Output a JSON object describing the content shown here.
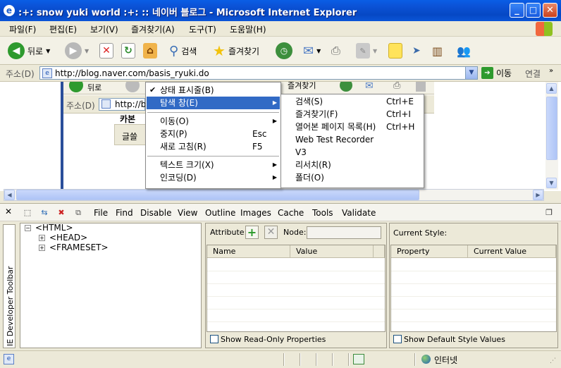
{
  "window": {
    "title": ":+: snow yuki world :+: :: 네이버 블로그 - Microsoft Internet Explorer",
    "minimize": "_",
    "maximize": "□",
    "close": "✕"
  },
  "menubar": [
    "파일(F)",
    "편집(E)",
    "보기(V)",
    "즐겨찾기(A)",
    "도구(T)",
    "도움말(H)"
  ],
  "toolbar": {
    "back": "뒤로",
    "search": "검색",
    "favorites": "즐겨찾기"
  },
  "address": {
    "label": "주소(D)",
    "url": "http://blog.naver.com/basis_ryuki.do",
    "go": "이동",
    "links": "연결"
  },
  "page_behind": {
    "back": "뒤로",
    "favorites": "즐겨찾기",
    "address_label": "주소(D)",
    "url": "http://b",
    "tab1": "카본",
    "tab2": "글쓸"
  },
  "context_menu": {
    "items": [
      {
        "label": "상태 표시줄(B)",
        "checked": "✔",
        "shortcut": "",
        "submenu": false
      },
      {
        "label": "탐색 창(E)",
        "checked": "",
        "shortcut": "",
        "submenu": true,
        "selected": true
      },
      {
        "label": "이동(O)",
        "checked": "",
        "shortcut": "",
        "submenu": true
      },
      {
        "label": "중지(P)",
        "checked": "",
        "shortcut": "Esc",
        "submenu": false
      },
      {
        "label": "새로 고침(R)",
        "checked": "",
        "shortcut": "F5",
        "submenu": false
      },
      {
        "label": "텍스트 크기(X)",
        "checked": "",
        "shortcut": "",
        "submenu": true
      },
      {
        "label": "인코딩(D)",
        "checked": "",
        "shortcut": "",
        "submenu": true
      }
    ],
    "arrow": "▶"
  },
  "submenu": {
    "items": [
      {
        "label": "검색(S)",
        "shortcut": "Ctrl+E"
      },
      {
        "label": "즐겨찾기(F)",
        "shortcut": "Ctrl+I"
      },
      {
        "label": "열어본 페이지 목록(H)",
        "shortcut": "Ctrl+H"
      },
      {
        "label": "Web Test Recorder",
        "shortcut": ""
      },
      {
        "label": "V3",
        "shortcut": ""
      },
      {
        "label": "리서치(R)",
        "shortcut": ""
      },
      {
        "label": "폴더(O)",
        "shortcut": ""
      }
    ]
  },
  "devtoolbar": {
    "close": "✕",
    "menus": [
      "File",
      "Find",
      "Disable",
      "View",
      "Outline",
      "Images",
      "Cache",
      "Tools",
      "Validate"
    ],
    "side_label": "IE Developer Toolbar"
  },
  "tree": {
    "root": "<HTML>",
    "children": [
      "<HEAD>",
      "<FRAMESET>"
    ],
    "minus": "−",
    "plus": "+"
  },
  "attributes": {
    "attribute_label": "Attribute:",
    "node_label": "Node:",
    "col_name": "Name",
    "col_value": "Value",
    "readonly_label": "Show Read-Only Properties"
  },
  "style": {
    "title": "Current Style:",
    "col_property": "Property",
    "col_value": "Current Value",
    "default_label": "Show Default Style Values"
  },
  "statusbar": {
    "zone": "인터넷"
  },
  "colors": {
    "titlebar": "#0a5ee6",
    "selection": "#316ac5",
    "chrome": "#ece9d8"
  }
}
